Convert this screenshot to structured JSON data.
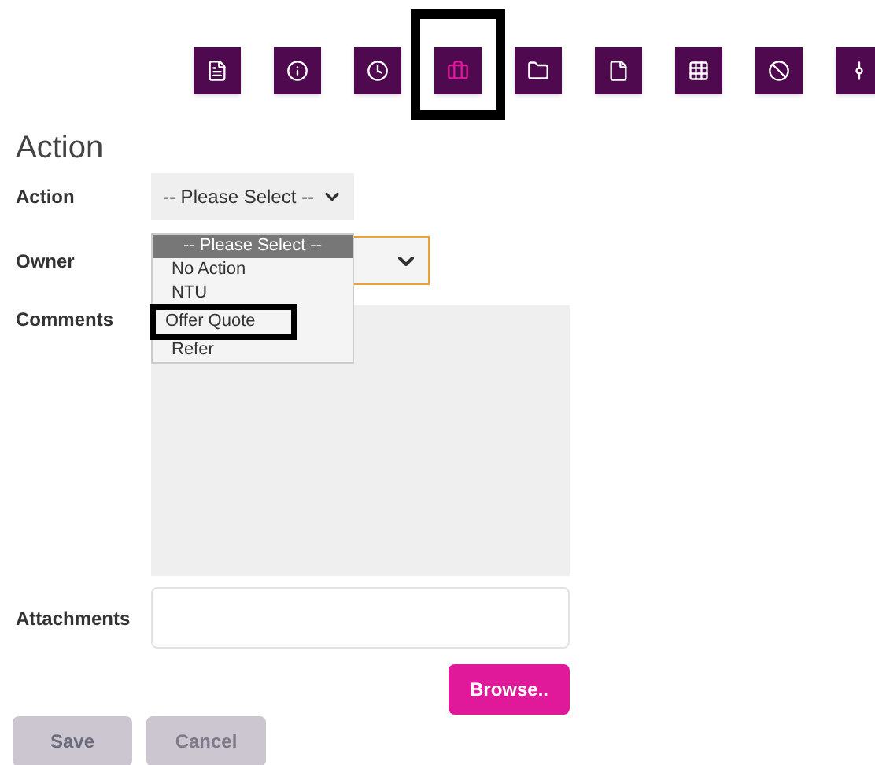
{
  "toolbar": [
    {
      "kind": "document",
      "selected": false
    },
    {
      "kind": "info",
      "selected": false
    },
    {
      "kind": "clock",
      "selected": false
    },
    {
      "kind": "briefcase",
      "selected": true
    },
    {
      "kind": "folder",
      "selected": false
    },
    {
      "kind": "copy",
      "selected": false
    },
    {
      "kind": "grid",
      "selected": false
    },
    {
      "kind": "ban",
      "selected": false
    },
    {
      "kind": "route",
      "selected": false
    }
  ],
  "heading": "Action",
  "action": {
    "label": "Action",
    "value": "-- Please Select --",
    "options": [
      {
        "label": "-- Please Select --",
        "selected": true
      },
      {
        "label": "No Action",
        "selected": false
      },
      {
        "label": "NTU",
        "selected": false
      },
      {
        "label": "Offer Quote",
        "selected": false
      },
      {
        "label": "Refer",
        "selected": false
      }
    ]
  },
  "owner": {
    "label": "Owner"
  },
  "comments": {
    "label": "Comments"
  },
  "attachments": {
    "label": "Attachments",
    "browse": "Browse.."
  },
  "buttons": [
    {
      "label": "Save",
      "kind": "save"
    },
    {
      "label": "Cancel",
      "kind": "cancel"
    }
  ]
}
